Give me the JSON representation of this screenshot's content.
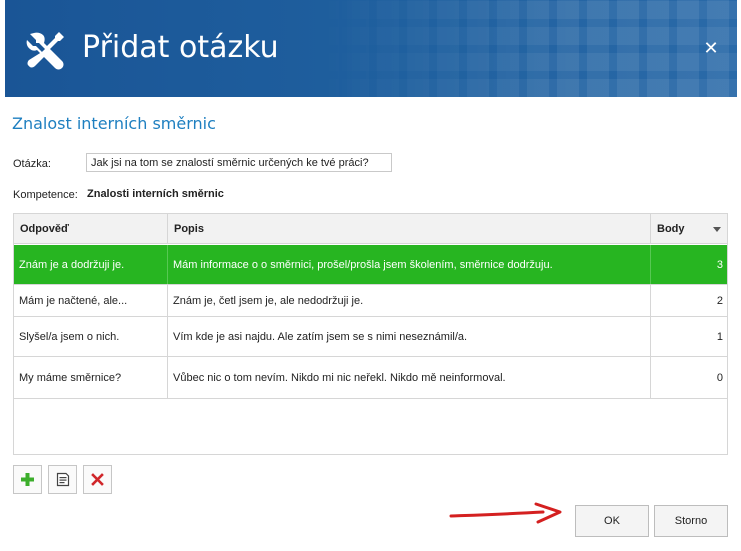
{
  "dialog": {
    "title": "Přidat otázku",
    "close_label": "✕"
  },
  "form": {
    "section_title": "Znalost interních směrnic",
    "question_label": "Otázka:",
    "question_value": "Jak jsi na tom se znalostí směrnic určených ke tvé práci?",
    "competence_label": "Kompetence:",
    "competence_value": "Znalosti interních směrnic"
  },
  "grid": {
    "columns": [
      "Odpověď",
      "Popis",
      "Body"
    ],
    "rows": [
      {
        "answer": "Znám je a dodržuji je.",
        "description": "Mám informace o o směrnici, prošel/prošla jsem školením, směrnice dodržuju.",
        "points": "3",
        "selected": true
      },
      {
        "answer": "Mám je načtené, ale...",
        "description": "Znám je, četl jsem je, ale nedodržuji je.",
        "points": "2",
        "selected": false
      },
      {
        "answer": "Slyšel/a jsem o nich.",
        "description": "Vím kde je asi najdu. Ale zatím jsem se s nimi neseznámil/a.",
        "points": "1",
        "selected": false
      },
      {
        "answer": "My máme směrnice?",
        "description": "Vůbec nic o tom nevím. Nikdo mi nic neřekl. Nikdo mě neinformoval.",
        "points": "0",
        "selected": false
      }
    ]
  },
  "toolbar": {
    "icons": [
      "add-icon",
      "edit-icon",
      "delete-icon"
    ]
  },
  "buttons": {
    "ok_label": "OK",
    "cancel_label": "Storno"
  },
  "colors": {
    "header_bg": "#1e5d9d",
    "accent": "#1e7fc0",
    "selected_row": "#27b521",
    "add_green": "#3cae2c",
    "delete_red": "#d0262a",
    "annotation_arrow": "#d42020"
  }
}
